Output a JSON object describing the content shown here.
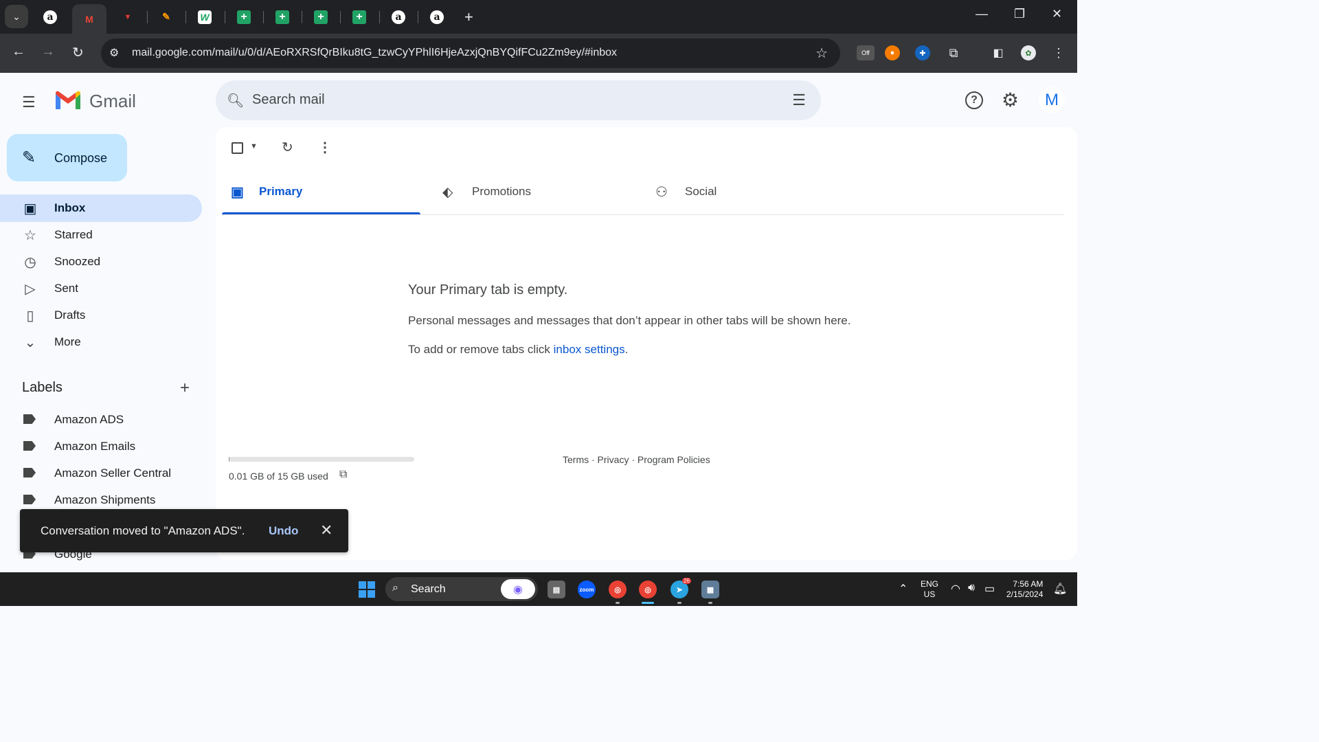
{
  "browser": {
    "url": "mail.google.com/mail/u/0/d/AEoRXRSfQrBIku8tG_tzwCyYPhlI6HjeAzxjQnBYQifFCu2Zm9ey/#inbox",
    "tabs": [
      {
        "icon": "amazon-favicon",
        "glyph": "a"
      },
      {
        "icon": "gmail-favicon",
        "glyph": "M"
      },
      {
        "icon": "red-logo-favicon",
        "glyph": "▼"
      },
      {
        "icon": "orange-pencil-favicon",
        "glyph": "✎"
      },
      {
        "icon": "w-favicon",
        "glyph": "W"
      },
      {
        "icon": "sheets-favicon",
        "glyph": "+"
      },
      {
        "icon": "sheets-favicon",
        "glyph": "+"
      },
      {
        "icon": "sheets-favicon",
        "glyph": "+"
      },
      {
        "icon": "sheets-favicon",
        "glyph": "+"
      },
      {
        "icon": "amazon-favicon",
        "glyph": "a"
      },
      {
        "icon": "amazon-favicon",
        "glyph": "a"
      }
    ],
    "extension_off_badge": "Off"
  },
  "gmail": {
    "logo_text": "Gmail",
    "search_placeholder": "Search mail",
    "avatar_letter": "M",
    "compose_label": "Compose",
    "nav": [
      {
        "label": "Inbox",
        "icon": "inbox-icon",
        "glyph": "▣",
        "active": true
      },
      {
        "label": "Starred",
        "icon": "star-icon",
        "glyph": "☆"
      },
      {
        "label": "Snoozed",
        "icon": "clock-icon",
        "glyph": "◷"
      },
      {
        "label": "Sent",
        "icon": "send-icon",
        "glyph": "▷"
      },
      {
        "label": "Drafts",
        "icon": "draft-icon",
        "glyph": "▯"
      },
      {
        "label": "More",
        "icon": "chevron-down-icon",
        "glyph": "⌄"
      }
    ],
    "labels_title": "Labels",
    "labels": [
      "Amazon ADS",
      "Amazon Emails",
      "Amazon Seller Central",
      "Amazon Shipments",
      "Google"
    ],
    "categories": [
      {
        "label": "Primary",
        "icon": "inbox-icon",
        "glyph": "▣",
        "active": true
      },
      {
        "label": "Promotions",
        "icon": "tag-icon",
        "glyph": "⬖"
      },
      {
        "label": "Social",
        "icon": "people-icon",
        "glyph": "⚇"
      }
    ],
    "empty": {
      "title": "Your Primary tab is empty.",
      "line1": "Personal messages and messages that don’t appear in other tabs will be shown here.",
      "line2_prefix": "To add or remove tabs click ",
      "line2_link": "inbox settings",
      "line2_suffix": "."
    },
    "storage": {
      "text": "0.01 GB of 15 GB used",
      "fraction": 0.001
    },
    "footer": "Terms · Privacy · Program Policies",
    "snackbar": {
      "message": "Conversation moved to \"Amazon ADS\".",
      "action": "Undo"
    }
  },
  "taskbar": {
    "search_text": "Search",
    "lang_top": "ENG",
    "lang_bottom": "US",
    "time": "7:56 AM",
    "date": "2/15/2024",
    "telegram_badge": "26",
    "zoom_label": "zoom"
  },
  "colors": {
    "accent": "#0b57d0",
    "compose": "#c2e7ff",
    "active_nav": "#d3e3fd"
  }
}
